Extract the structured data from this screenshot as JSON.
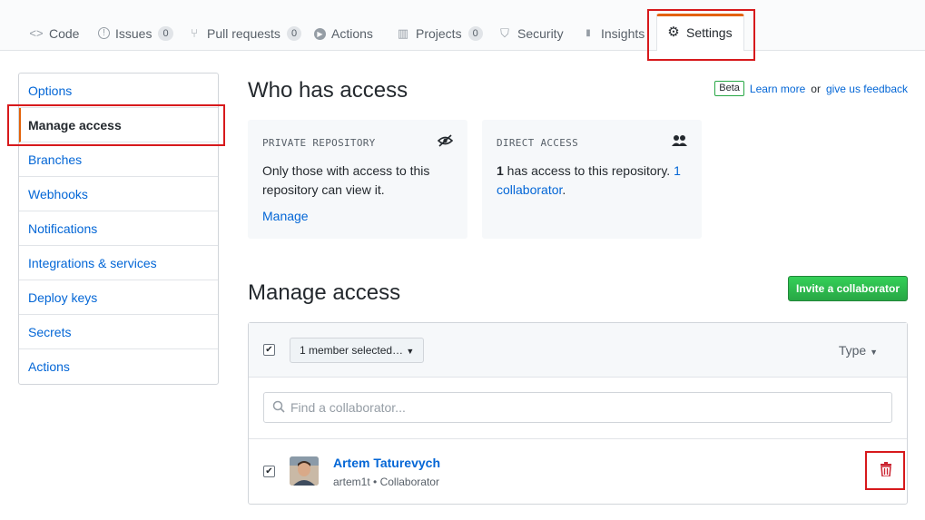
{
  "tabs": [
    {
      "icon": "code-icon",
      "glyph": "<>",
      "label": "Code"
    },
    {
      "icon": "issue-icon",
      "glyph": "!",
      "label": "Issues",
      "count": "0"
    },
    {
      "icon": "pull-request-icon",
      "glyph": "⑂",
      "label": "Pull requests",
      "count": "0"
    },
    {
      "icon": "play-icon",
      "glyph": "▶",
      "label": "Actions"
    },
    {
      "icon": "project-icon",
      "glyph": "▥",
      "label": "Projects",
      "count": "0"
    },
    {
      "icon": "shield-icon",
      "glyph": "⛉",
      "label": "Security"
    },
    {
      "icon": "graph-icon",
      "glyph": "▮",
      "label": "Insights"
    },
    {
      "icon": "gear-icon",
      "glyph": "⚙",
      "label": "Settings"
    }
  ],
  "sidebar": {
    "items": [
      {
        "label": "Options"
      },
      {
        "label": "Manage access"
      },
      {
        "label": "Branches"
      },
      {
        "label": "Webhooks"
      },
      {
        "label": "Notifications"
      },
      {
        "label": "Integrations & services"
      },
      {
        "label": "Deploy keys"
      },
      {
        "label": "Secrets"
      },
      {
        "label": "Actions"
      }
    ]
  },
  "who": {
    "title": "Who has access",
    "beta": "Beta",
    "learn_more": "Learn more",
    "or": "or",
    "feedback": "give us feedback"
  },
  "private_box": {
    "heading": "PRIVATE REPOSITORY",
    "icon": "eye-closed-icon",
    "text": "Only those with access to this repository can view it.",
    "link": "Manage"
  },
  "direct_box": {
    "heading": "DIRECT ACCESS",
    "icon": "people-icon",
    "count": "1",
    "text": " has access to this repository. ",
    "link": "1 collaborator",
    "end": "."
  },
  "manage": {
    "title": "Manage access",
    "invite_label": "Invite a collaborator",
    "selected_label": "1 member selected…",
    "type_label": "Type",
    "search_placeholder": "Find a collaborator..."
  },
  "members": [
    {
      "name": "Artem Taturevych",
      "username": "artem1t",
      "role": "Collaborator",
      "separator": "•"
    }
  ],
  "colors": {
    "accent": "#e36209",
    "link": "#0366d6",
    "highlight": "#d7191c",
    "green": "#28a745",
    "danger": "#cb2431"
  }
}
